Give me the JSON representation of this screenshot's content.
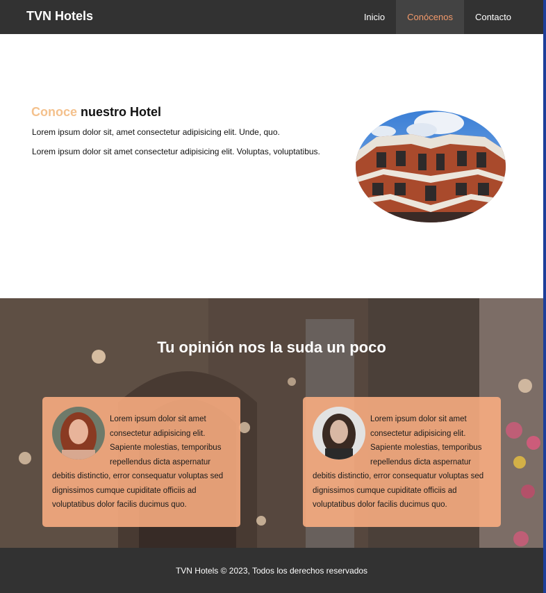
{
  "header": {
    "brand": "TVN Hotels",
    "nav": [
      "Inicio",
      "Conócenos",
      "Contacto"
    ],
    "active_index": 1
  },
  "about": {
    "title_accent": "Conoce",
    "title_rest": "nuestro Hotel",
    "paragraph_1": "Lorem ipsum dolor sit, amet consectetur adipisicing elit. Unde, quo.",
    "paragraph_2": "Lorem ipsum dolor sit amet consectetur adipisicing elit. Voluptas, voluptatibus."
  },
  "testimonials": {
    "title": "Tu opinión nos la suda un poco",
    "cards": [
      {
        "text": "Lorem ipsum dolor sit amet consectetur adipisicing elit. Sapiente molestias, temporibus repellendus dicta aspernatur debitis distinctio, error consequatur voluptas sed dignissimos cumque cupiditate officiis ad voluptatibus dolor facilis ducimus quo."
      },
      {
        "text": "Lorem ipsum dolor sit amet consectetur adipisicing elit. Sapiente molestias, temporibus repellendus dicta aspernatur debitis distinctio, error consequatur voluptas sed dignissimos cumque cupiditate officiis ad voluptatibus dolor facilis ducimus quo."
      }
    ]
  },
  "footer": {
    "text": "TVN Hotels © 2023, Todos los derechos reservados"
  },
  "colors": {
    "navbar": "#323232",
    "accent_nav": "#f39a6b",
    "accent_title": "#f4c18d",
    "card": "#fcae82"
  }
}
